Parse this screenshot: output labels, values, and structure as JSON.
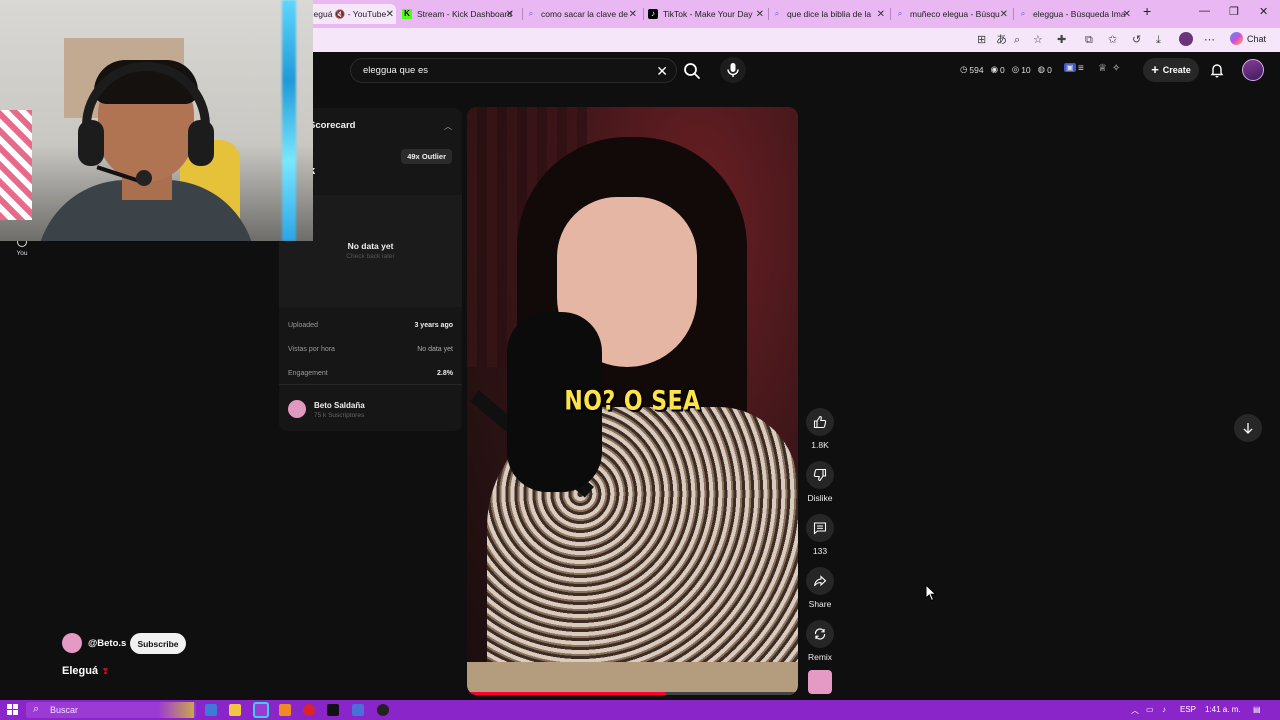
{
  "browser": {
    "tabs": [
      {
        "label": "Eleguá 🔇 - YouTube",
        "favicon": "youtube-favicon",
        "active": true
      },
      {
        "label": "Stream - Kick Dashboard",
        "favicon": "kick-favicon",
        "active": false
      },
      {
        "label": "como sacar la clave de",
        "favicon": "search-favicon",
        "active": false
      },
      {
        "label": "TikTok - Make Your Day",
        "favicon": "tiktok-favicon",
        "active": false
      },
      {
        "label": "que dice la biblia de la",
        "favicon": "search-favicon",
        "active": false
      },
      {
        "label": "muñeco elegua - Búsqu",
        "favicon": "search-favicon",
        "active": false
      },
      {
        "label": "eleggua - Búsqueda Ima",
        "favicon": "search-favicon",
        "active": false
      }
    ],
    "new_tab": "+",
    "chat_label": "Chat"
  },
  "youtube": {
    "search_value": "eleggua que es",
    "stats": {
      "time": "594",
      "views": "0",
      "eye": "10",
      "mouse": "0"
    },
    "create_label": "Create",
    "you_label": "You"
  },
  "scorecard": {
    "title": "Scorecard",
    "badge": "49x Outlier",
    "partial": "k",
    "no_data": "No data yet",
    "check_back": "Check back later",
    "rows": [
      {
        "label": "Uploaded",
        "value": "3 years ago"
      },
      {
        "label": "Vistas por hora",
        "value": "No data yet"
      },
      {
        "label": "Engagement",
        "value": "2.8%"
      }
    ],
    "channel_name": "Beto Saldaña",
    "channel_subs": "75 k Suscriptores"
  },
  "video": {
    "caption": "NO? O SEA",
    "progress": 0.6
  },
  "actions": {
    "like_count": "1.8K",
    "dislike_label": "Dislike",
    "comments_count": "133",
    "share_label": "Share",
    "remix_label": "Remix"
  },
  "short_info": {
    "handle": "@Beto.s",
    "subscribe_label": "Subscribe",
    "title": "Eleguá"
  },
  "taskbar": {
    "search_placeholder": "Buscar",
    "lang": "ESP",
    "time": "1:41 a. m."
  },
  "colors": {
    "tabstrip": "#e9b8f2",
    "taskbar": "#8a26c9",
    "caption": "#ffe34a",
    "progress": "#ff0033"
  }
}
